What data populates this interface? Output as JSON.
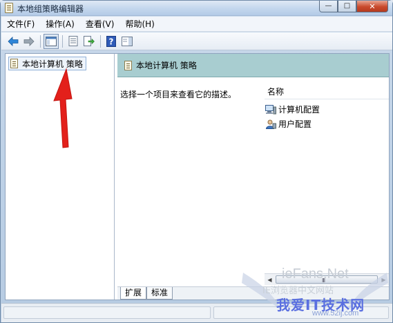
{
  "window": {
    "title": "本地组策略编辑器",
    "controls": {
      "minimize": "—",
      "maximize": "□",
      "close": "✕"
    }
  },
  "menu": [
    "文件(F)",
    "操作(A)",
    "查看(V)",
    "帮助(H)"
  ],
  "toolbar_icons": [
    "back-arrow-icon",
    "forward-arrow-icon",
    "show-hide-tree-icon",
    "properties-icon",
    "export-list-icon",
    "help-icon",
    "show-hide-action-pane-icon"
  ],
  "tree": {
    "root_label": "本地计算机 策略"
  },
  "right_pane": {
    "header_title": "本地计算机 策略",
    "description": "选择一个项目来查看它的描述。",
    "column_name": "名称",
    "items": [
      {
        "label": "计算机配置",
        "icon": "computer-config-icon"
      },
      {
        "label": "用户配置",
        "icon": "user-config-icon"
      }
    ],
    "scroll_grip": "III"
  },
  "tabs": [
    "扩展",
    "标准"
  ],
  "watermark": {
    "line1": "ieFans.Net",
    "line2": "IE浏览器中文网站",
    "line3": "我爱IT技术网",
    "line4": "www.52ij.com"
  },
  "colors": {
    "pane_header": "#a8cdd0",
    "annotation_arrow": "#e3201b",
    "close_button": "#c94a2c"
  }
}
